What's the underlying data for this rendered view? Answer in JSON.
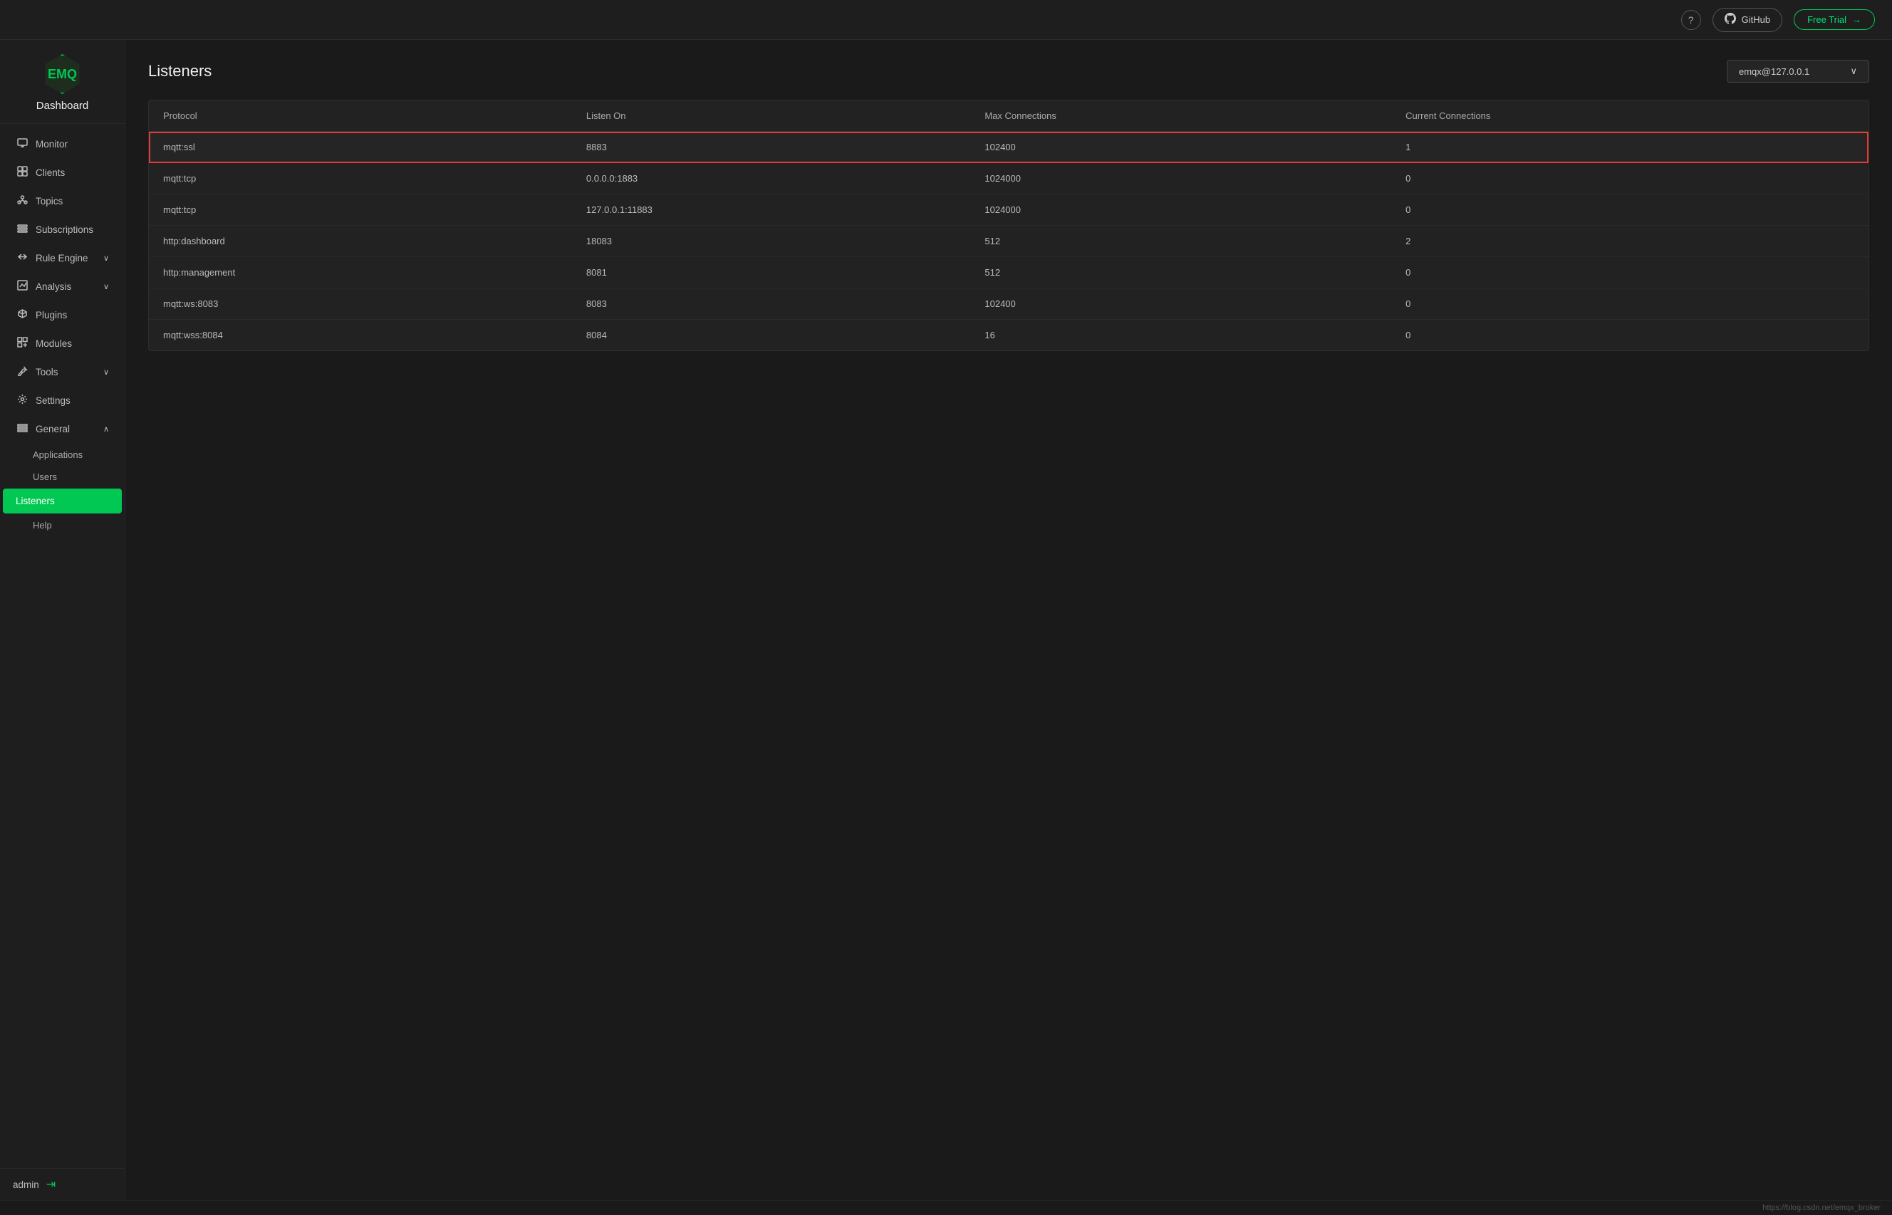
{
  "topbar": {
    "help_label": "?",
    "github_label": "GitHub",
    "github_icon": "⬤",
    "freetrial_label": "Free Trial",
    "freetrial_arrow": "→"
  },
  "sidebar": {
    "logo_text": "EMQ",
    "dashboard_label": "Dashboard",
    "nav_items": [
      {
        "id": "monitor",
        "label": "Monitor",
        "icon": "▤",
        "has_arrow": false
      },
      {
        "id": "clients",
        "label": "Clients",
        "icon": "⊞",
        "has_arrow": false
      },
      {
        "id": "topics",
        "label": "Topics",
        "icon": "⊟",
        "has_arrow": false
      },
      {
        "id": "subscriptions",
        "label": "Subscriptions",
        "icon": "☰",
        "has_arrow": false
      },
      {
        "id": "rule-engine",
        "label": "Rule Engine",
        "icon": "⋗",
        "has_arrow": true
      },
      {
        "id": "analysis",
        "label": "Analysis",
        "icon": "▣",
        "has_arrow": true
      },
      {
        "id": "plugins",
        "label": "Plugins",
        "icon": "✓",
        "has_arrow": false
      },
      {
        "id": "modules",
        "label": "Modules",
        "icon": "⊠",
        "has_arrow": false
      },
      {
        "id": "tools",
        "label": "Tools",
        "icon": "⚙",
        "has_arrow": true
      },
      {
        "id": "settings",
        "label": "Settings",
        "icon": "⚙",
        "has_arrow": false
      },
      {
        "id": "general",
        "label": "General",
        "icon": "≡",
        "has_arrow": true
      }
    ],
    "subitems": [
      {
        "id": "applications",
        "label": "Applications"
      },
      {
        "id": "users",
        "label": "Users"
      },
      {
        "id": "listeners",
        "label": "Listeners",
        "active": true
      },
      {
        "id": "help",
        "label": "Help"
      }
    ],
    "user_label": "admin",
    "logout_icon": "⇥"
  },
  "page": {
    "title": "Listeners",
    "node_selector": "emqx@127.0.0.1",
    "node_selector_arrow": "∨"
  },
  "table": {
    "columns": [
      "Protocol",
      "Listen On",
      "Max Connections",
      "Current Connections"
    ],
    "rows": [
      {
        "protocol": "mqtt:ssl",
        "listen_on": "8883",
        "max_connections": "102400",
        "current_connections": "1",
        "highlighted": true
      },
      {
        "protocol": "mqtt:tcp",
        "listen_on": "0.0.0.0:1883",
        "max_connections": "1024000",
        "current_connections": "0",
        "highlighted": false
      },
      {
        "protocol": "mqtt:tcp",
        "listen_on": "127.0.0.1:11883",
        "max_connections": "1024000",
        "current_connections": "0",
        "highlighted": false
      },
      {
        "protocol": "http:dashboard",
        "listen_on": "18083",
        "max_connections": "512",
        "current_connections": "2",
        "highlighted": false
      },
      {
        "protocol": "http:management",
        "listen_on": "8081",
        "max_connections": "512",
        "current_connections": "0",
        "highlighted": false
      },
      {
        "protocol": "mqtt:ws:8083",
        "listen_on": "8083",
        "max_connections": "102400",
        "current_connections": "0",
        "highlighted": false
      },
      {
        "protocol": "mqtt:wss:8084",
        "listen_on": "8084",
        "max_connections": "16",
        "current_connections": "0",
        "highlighted": false
      }
    ]
  },
  "bottombar": {
    "url": "https://blog.csdn.net/emqx_broker"
  }
}
